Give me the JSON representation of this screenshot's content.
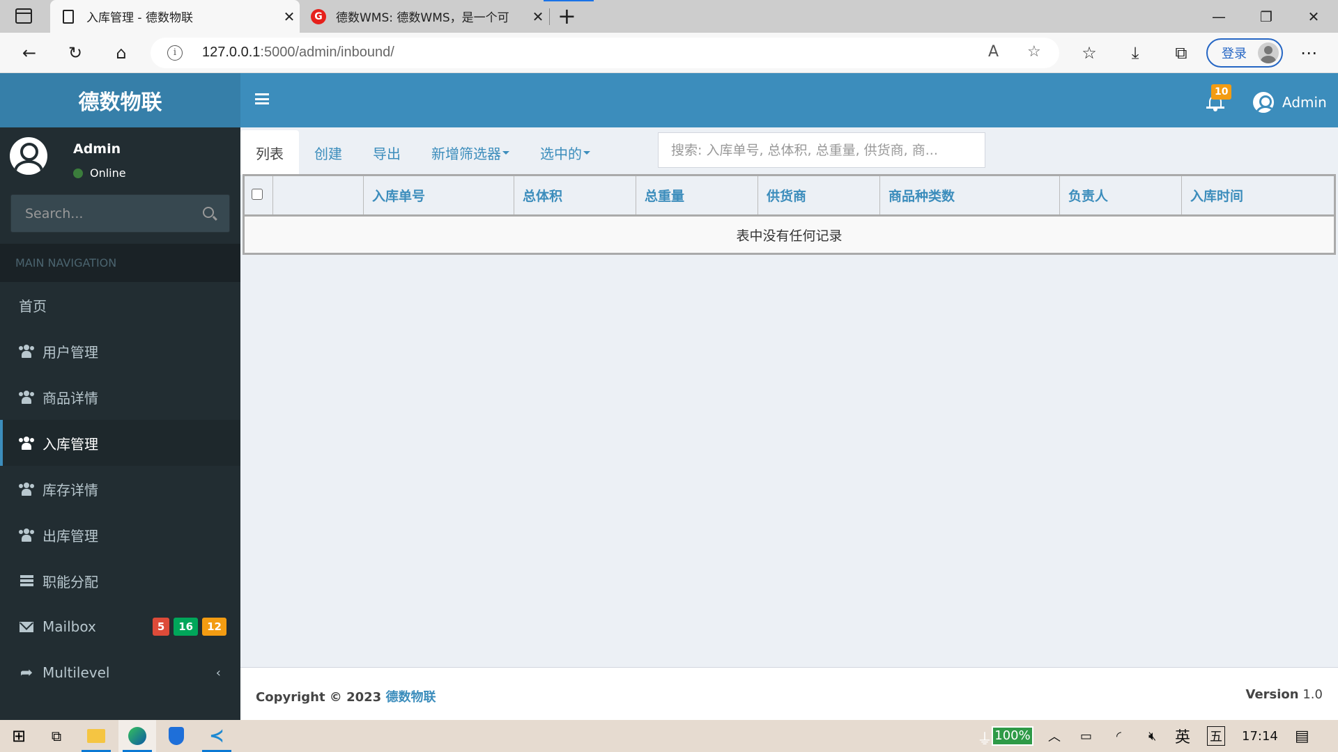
{
  "browser": {
    "tabs": [
      {
        "title": "入库管理 - 德数物联",
        "active": true,
        "icon": "page-icon"
      },
      {
        "title": "德数WMS: 德数WMS，是一个可",
        "active": false,
        "icon": "gitee-icon"
      }
    ],
    "url_host": "127.0.0.1",
    "url_rest": ":5000/admin/inbound/",
    "login_label": "登录"
  },
  "header": {
    "logo": "德数物联",
    "notifications_count": "10",
    "user_name": "Admin"
  },
  "sidebar": {
    "user_name": "Admin",
    "status": "Online",
    "search_placeholder": "Search...",
    "nav_header": "MAIN NAVIGATION",
    "items": [
      {
        "label": "首页",
        "icon": "none",
        "active": false
      },
      {
        "label": "用户管理",
        "icon": "users-icon",
        "active": false
      },
      {
        "label": "商品详情",
        "icon": "users-icon",
        "active": false
      },
      {
        "label": "入库管理",
        "icon": "users-icon",
        "active": true
      },
      {
        "label": "库存详情",
        "icon": "users-icon",
        "active": false
      },
      {
        "label": "出库管理",
        "icon": "users-icon",
        "active": false
      },
      {
        "label": "职能分配",
        "icon": "server-icon",
        "active": false
      },
      {
        "label": "Mailbox",
        "icon": "envelope-icon",
        "active": false,
        "badges": [
          {
            "value": "5",
            "color": "#dd4b39"
          },
          {
            "value": "16",
            "color": "#00a65a"
          },
          {
            "value": "12",
            "color": "#f39c12"
          }
        ]
      },
      {
        "label": "Multilevel",
        "icon": "share-icon",
        "active": false
      }
    ]
  },
  "main": {
    "tabs": [
      {
        "label": "列表",
        "active": true
      },
      {
        "label": "创建"
      },
      {
        "label": "导出"
      },
      {
        "label": "新增筛选器",
        "dropdown": true
      },
      {
        "label": "选中的",
        "dropdown": true
      }
    ],
    "search_placeholder": "搜索: 入库单号, 总体积, 总重量, 供货商, 商...",
    "table": {
      "columns": [
        "",
        "",
        "入库单号",
        "总体积",
        "总重量",
        "供货商",
        "商品种类数",
        "负责人",
        "入库时间"
      ],
      "empty_message": "表中没有任何记录"
    }
  },
  "footer": {
    "copyright": "Copyright © 2023",
    "brand": "德数物联",
    "version_label": "Version",
    "version": "1.0"
  },
  "taskbar": {
    "battery": "100%",
    "ime": "英",
    "ime2": "五",
    "time": "17:14"
  },
  "colors": {
    "primary": "#3c8dbc",
    "sidebar": "#222d32"
  }
}
